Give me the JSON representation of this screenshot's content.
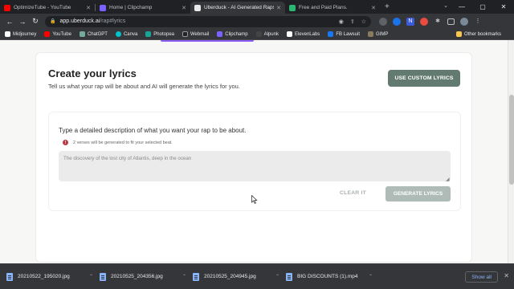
{
  "browser": {
    "tabs": [
      {
        "title": "OptimizeTube - YouTube",
        "color": "#ff0000",
        "active": false
      },
      {
        "title": "Home | Clipchamp",
        "color": "#7b61ff",
        "active": false
      },
      {
        "title": "Uberduck - AI Generated Raps",
        "color": "#e8e8e8",
        "active": true
      },
      {
        "title": "Free and Paid Plans.",
        "color": "#2bb673",
        "active": false
      }
    ],
    "url_host": "app.uberduck.ai",
    "url_path": "/rap#lyrics",
    "bookmarks": [
      {
        "label": "Midjourney",
        "color": "#ffffff"
      },
      {
        "label": "YouTube",
        "color": "#ff0000"
      },
      {
        "label": "ChatGPT",
        "color": "#74aa9c"
      },
      {
        "label": "Canva",
        "color": "#00c4cc"
      },
      {
        "label": "Photopea",
        "color": "#18a497"
      },
      {
        "label": "Webmail",
        "color": "#222222"
      },
      {
        "label": "Clipchamp",
        "color": "#7b61ff"
      },
      {
        "label": "Alpunk",
        "color": "#444444"
      },
      {
        "label": "ElevenLabs",
        "color": "#ffffff"
      },
      {
        "label": "FB Lawsuit",
        "color": "#1877f2"
      },
      {
        "label": "GIMP",
        "color": "#8a7a5e"
      }
    ],
    "other_bookmarks": "Other bookmarks"
  },
  "page": {
    "title": "Create your lyrics",
    "description": "Tell us what your rap will be about and AI will generate the lyrics for you.",
    "custom_button": "USE CUSTOM LYRICS",
    "prompt_label": "Type a detailed description of what you want your rap to be about.",
    "info_icon_glyph": "!",
    "info_text": "2 verses will be generated to fit your selected beat.",
    "textarea_value": "The discovery of the lost city of Atlantis, deep in the ocean",
    "clear_button": "CLEAR IT",
    "generate_button": "GENERATE LYRICS",
    "accent_color": "#637a71"
  },
  "downloads": {
    "items": [
      {
        "name": "20210522_195020.jpg"
      },
      {
        "name": "20210525_204356.jpg"
      },
      {
        "name": "20210525_204945.jpg"
      },
      {
        "name": "BIG DISCOUNTS (1).mp4"
      }
    ],
    "show_all": "Show all"
  }
}
